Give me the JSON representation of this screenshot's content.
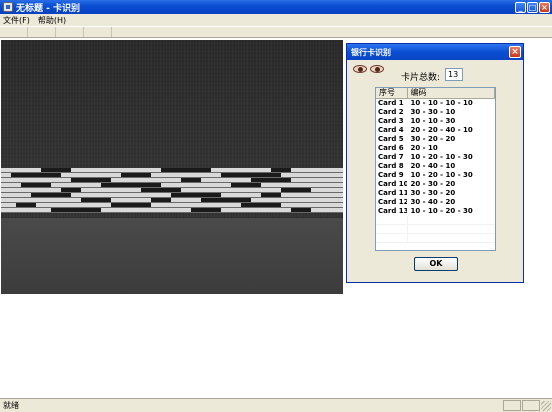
{
  "window": {
    "title": "无标题 - 卡识别",
    "minimize": "_",
    "maximize": "□",
    "close": "×"
  },
  "menu": {
    "items": [
      {
        "label": "文件(F)"
      },
      {
        "label": "帮助(H)"
      }
    ]
  },
  "dialog": {
    "title": "银行卡识别",
    "close": "×",
    "count_label": "卡片总数:",
    "count_value": "13",
    "columns": [
      "序号",
      "编码"
    ],
    "rows": [
      {
        "id": "Card 1",
        "code": "10 - 10 - 10 - 10"
      },
      {
        "id": "Card 2",
        "code": "30 - 30 - 10"
      },
      {
        "id": "Card 3",
        "code": "10 - 10 - 30"
      },
      {
        "id": "Card 4",
        "code": "20 - 20 - 40 - 10"
      },
      {
        "id": "Card 5",
        "code": "30 - 20 - 20"
      },
      {
        "id": "Card 6",
        "code": "20 - 10"
      },
      {
        "id": "Card 7",
        "code": "10 - 20 - 10 - 30"
      },
      {
        "id": "Card 8",
        "code": "20 - 40 - 10"
      },
      {
        "id": "Card 9",
        "code": "10 - 20 - 10 - 30"
      },
      {
        "id": "Card 10",
        "code": "20 - 30 - 20"
      },
      {
        "id": "Card 11",
        "code": "30 - 30 - 20"
      },
      {
        "id": "Card 12",
        "code": "30 - 40 - 20"
      },
      {
        "id": "Card 13",
        "code": "10 - 10 - 20 - 30"
      }
    ],
    "ok_label": "OK"
  },
  "statusbar": {
    "text": "就绪"
  }
}
